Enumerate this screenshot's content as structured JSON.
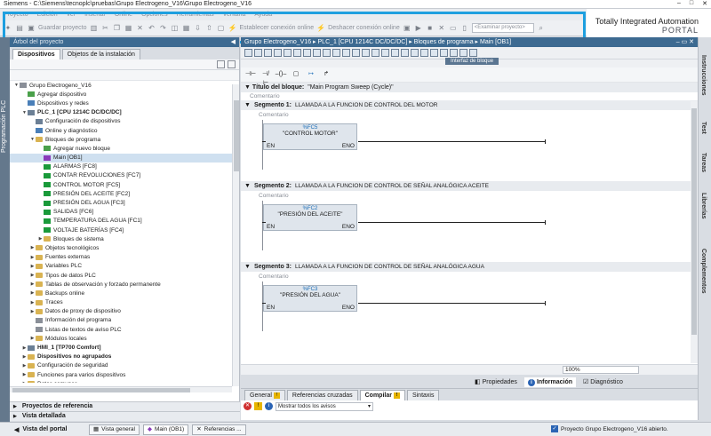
{
  "window": {
    "title": "Siemens - C:\\Siemens\\tecnoplc\\pruebas\\Grupo Electrogeno_V16\\Grupo Electrogeno_V16",
    "buttons": [
      "–",
      "□",
      "✕"
    ]
  },
  "menu": {
    "items": [
      "Proyecto",
      "Edición",
      "Ver",
      "Insertar",
      "Online",
      "Opciones",
      "Herramientas",
      "Ventana",
      "Ayuda"
    ]
  },
  "toolbar": {
    "save_label": "Guardar proyecto",
    "go_online_label": "Establecer conexión online",
    "go_offline_label": "Deshacer conexión online",
    "search_placeholder": "<Examinar proyecto>"
  },
  "brand": {
    "line1": "Totally Integrated Automation",
    "line2": "PORTAL"
  },
  "left_rail": {
    "label": "Programación PLC"
  },
  "project_tree": {
    "header": "Árbol del proyecto",
    "tabs": [
      "Dispositivos",
      "Objetos de la instalación"
    ],
    "items": [
      {
        "label": "Grupo Electrogeno_V16",
        "level": 0,
        "tw": "▼",
        "icon": "project",
        "selected": false
      },
      {
        "label": "Agregar dispositivo",
        "level": 1,
        "tw": "",
        "icon": "add-device",
        "selected": false
      },
      {
        "label": "Dispositivos y redes",
        "level": 1,
        "tw": "",
        "icon": "network",
        "selected": false
      },
      {
        "label": "PLC_1 [CPU 1214C DC/DC/DC]",
        "level": 1,
        "tw": "▼",
        "icon": "plc",
        "selected": false
      },
      {
        "label": "Configuración de dispositivos",
        "level": 2,
        "tw": "",
        "icon": "device-config",
        "selected": false
      },
      {
        "label": "Online y diagnóstico",
        "level": 2,
        "tw": "",
        "icon": "diagnostics",
        "selected": false
      },
      {
        "label": "Bloques de programa",
        "level": 2,
        "tw": "▼",
        "icon": "folder",
        "selected": false
      },
      {
        "label": "Agregar nuevo bloque",
        "level": 3,
        "tw": "",
        "icon": "add-block",
        "selected": false
      },
      {
        "label": "Main [OB1]",
        "level": 3,
        "tw": "",
        "icon": "ob-block",
        "selected": true
      },
      {
        "label": "ALARMAS [FC8]",
        "level": 3,
        "tw": "",
        "icon": "fc-block",
        "selected": false
      },
      {
        "label": "CONTAR REVOLUCIONES [FC7]",
        "level": 3,
        "tw": "",
        "icon": "fc-block",
        "selected": false
      },
      {
        "label": "CONTROL MOTOR [FC5]",
        "level": 3,
        "tw": "",
        "icon": "fc-block",
        "selected": false
      },
      {
        "label": "PRESIÓN DEL ACEITE [FC2]",
        "level": 3,
        "tw": "",
        "icon": "fc-block",
        "selected": false
      },
      {
        "label": "PRESIÓN DEL AGUA [FC3]",
        "level": 3,
        "tw": "",
        "icon": "fc-block",
        "selected": false
      },
      {
        "label": "SALIDAS [FC6]",
        "level": 3,
        "tw": "",
        "icon": "fc-block",
        "selected": false
      },
      {
        "label": "TEMPERATURA DEL AGUA [FC1]",
        "level": 3,
        "tw": "",
        "icon": "fc-block",
        "selected": false
      },
      {
        "label": "VOLTAJE BATERÍAS [FC4]",
        "level": 3,
        "tw": "",
        "icon": "fc-block",
        "selected": false
      },
      {
        "label": "Bloques de sistema",
        "level": 3,
        "tw": "▶",
        "icon": "folder",
        "selected": false
      },
      {
        "label": "Objetos tecnológicos",
        "level": 2,
        "tw": "▶",
        "icon": "folder",
        "selected": false
      },
      {
        "label": "Fuentes externas",
        "level": 2,
        "tw": "▶",
        "icon": "folder",
        "selected": false
      },
      {
        "label": "Variables PLC",
        "level": 2,
        "tw": "▶",
        "icon": "folder",
        "selected": false
      },
      {
        "label": "Tipos de datos PLC",
        "level": 2,
        "tw": "▶",
        "icon": "folder",
        "selected": false
      },
      {
        "label": "Tablas de observación y forzado permanente",
        "level": 2,
        "tw": "▶",
        "icon": "folder",
        "selected": false
      },
      {
        "label": "Backups online",
        "level": 2,
        "tw": "▶",
        "icon": "folder",
        "selected": false
      },
      {
        "label": "Traces",
        "level": 2,
        "tw": "▶",
        "icon": "folder",
        "selected": false
      },
      {
        "label": "Datos de proxy de dispositivo",
        "level": 2,
        "tw": "▶",
        "icon": "folder",
        "selected": false
      },
      {
        "label": "Información del programa",
        "level": 2,
        "tw": "",
        "icon": "doc",
        "selected": false
      },
      {
        "label": "Listas de textos de aviso PLC",
        "level": 2,
        "tw": "",
        "icon": "doc",
        "selected": false
      },
      {
        "label": "Módulos locales",
        "level": 2,
        "tw": "▶",
        "icon": "folder",
        "selected": false
      },
      {
        "label": "HMI_1 [TP700 Comfort]",
        "level": 1,
        "tw": "▶",
        "icon": "hmi",
        "selected": false
      },
      {
        "label": "Dispositivos no agrupados",
        "level": 1,
        "tw": "▶",
        "icon": "folder",
        "selected": false
      },
      {
        "label": "Configuración de seguridad",
        "level": 1,
        "tw": "▶",
        "icon": "folder",
        "selected": false
      },
      {
        "label": "Funciones para varios dispositivos",
        "level": 1,
        "tw": "▶",
        "icon": "folder",
        "selected": false
      },
      {
        "label": "Datos comunes",
        "level": 1,
        "tw": "▶",
        "icon": "folder",
        "selected": false
      }
    ],
    "reference_projects": "Proyectos de referencia",
    "detail_view": "Vista detallada"
  },
  "editor": {
    "breadcrumb": "Grupo Electrogeno_V16 ▸ PLC_1 [CPU 1214C DC/DC/DC] ▸ Bloques de programa ▸ Main [OB1]",
    "interface_label": "Interfaz de bloque",
    "block_title_label": "Título del bloque:",
    "block_title_value": "\"Main Program Sweep (Cycle)\"",
    "comment_label": "Comentario",
    "segments": [
      {
        "label": "Segmento 1:",
        "desc": "LLAMADA A LA FUNCION DE CONTROL DEL  MOTOR",
        "fc": "%FC5",
        "name": "\"CONTROL MOTOR\"",
        "en": "EN",
        "eno": "ENO"
      },
      {
        "label": "Segmento 2:",
        "desc": "LLAMADA A LA FUNCION DE CONTROL DE SEÑAL ANALÓGICA ACEITE",
        "fc": "%FC2",
        "name": "\"PRESIÓN DEL ACEITE\"",
        "en": "EN",
        "eno": "ENO"
      },
      {
        "label": "Segmento 3:",
        "desc": "LLAMADA A LA FUNCION DE CONTROL DE SEÑAL ANALÓGICA AGUA",
        "fc": "%FC3",
        "name": "\"PRESIÓN DEL AGUA\"",
        "en": "EN",
        "eno": "ENO"
      }
    ],
    "zoom": "100%"
  },
  "inspector": {
    "tabs": [
      "Propiedades",
      "Información",
      "Diagnóstico"
    ]
  },
  "bottom_panel": {
    "tabs": [
      "General",
      "Referencias cruzadas",
      "Compilar",
      "Sintaxis"
    ],
    "filter": "Mostrar todos los avisos"
  },
  "right_rail": {
    "tabs": [
      "Instrucciones",
      "Test",
      "Tareas",
      "Librerías",
      "Complementos"
    ]
  },
  "statusbar": {
    "portal_view": "Vista del portal",
    "tabs": [
      "Vista general",
      "Main (OB1)",
      "Referencias ..."
    ],
    "status": "Proyecto Grupo Electrogeno_V16 abierto."
  },
  "colors": {
    "highlight": "#1d9fdf",
    "header_blue": "#3d6a91",
    "selection": "#cfe0f0",
    "fc_green": "#1a9a3a",
    "ob_purple": "#8a3ab9"
  }
}
